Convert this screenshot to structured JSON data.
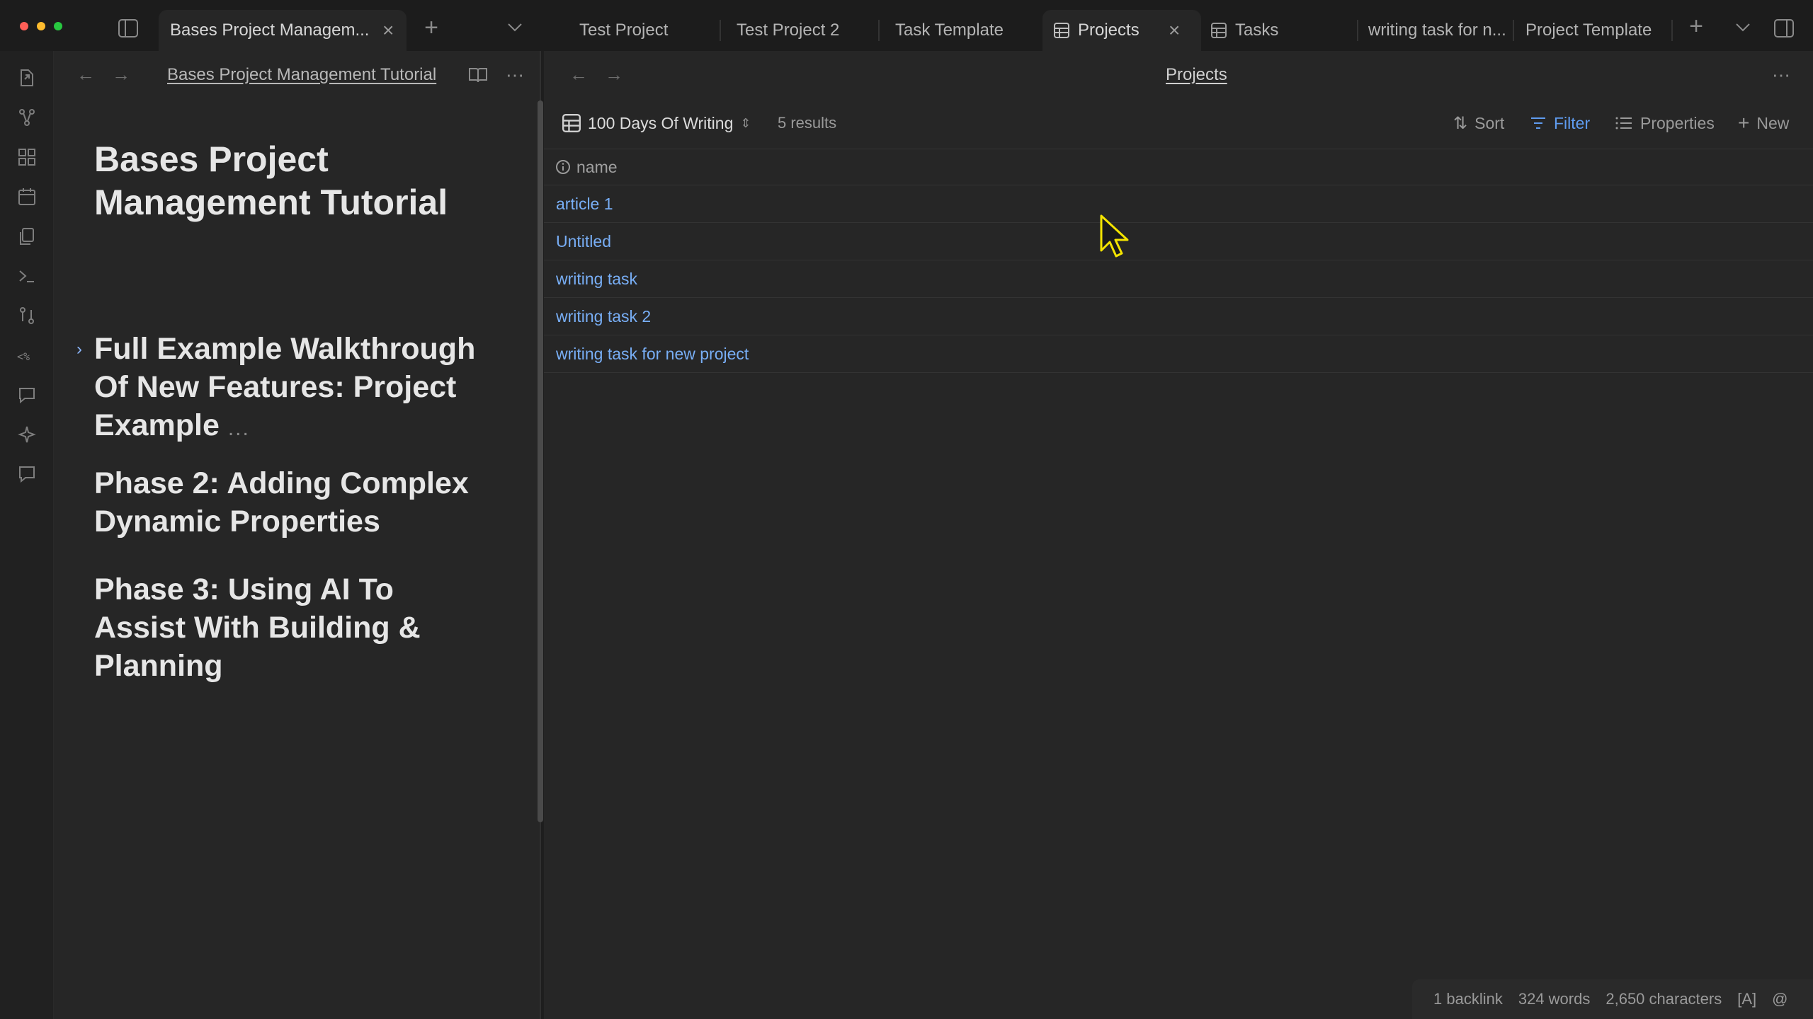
{
  "tabs": [
    {
      "label": "Bases Project Managem...",
      "active": true,
      "closable": true
    },
    {
      "label": "Test Project"
    },
    {
      "label": "Test Project 2"
    },
    {
      "label": "Task Template"
    },
    {
      "label": "Projects",
      "active": true,
      "closable": true,
      "icon": "table-icon"
    },
    {
      "label": "Tasks",
      "icon": "table-icon"
    },
    {
      "label": "writing task for n..."
    },
    {
      "label": "Project Template"
    }
  ],
  "left_pane": {
    "breadcrumb": "Bases Project Management Tutorial",
    "title": "Bases Project Management Tutorial",
    "headings": [
      "Full Example Walkthrough Of New Features: Project Example",
      "Phase 2: Adding Complex Dynamic Properties",
      "Phase 3: Using AI To Assist With Building & Planning"
    ],
    "collapsed_marker": "..."
  },
  "right_pane": {
    "view_title": "Projects",
    "view_name": "100 Days Of Writing",
    "results": "5 results",
    "toolbar": {
      "sort": "Sort",
      "filter": "Filter",
      "properties": "Properties",
      "new": "New"
    },
    "column_header": "name",
    "rows": [
      "article 1",
      "Untitled",
      "writing task",
      "writing task 2",
      "writing task for new project"
    ]
  },
  "status_bar": {
    "backlinks": "1 backlink",
    "words": "324 words",
    "characters": "2,650 characters",
    "mode": "[A]",
    "at": "@"
  },
  "colors": {
    "accent": "#5f9cf0",
    "link": "#78aef5",
    "traffic_red": "#ff5f57",
    "traffic_yellow": "#febc2e",
    "traffic_green": "#28c840"
  }
}
